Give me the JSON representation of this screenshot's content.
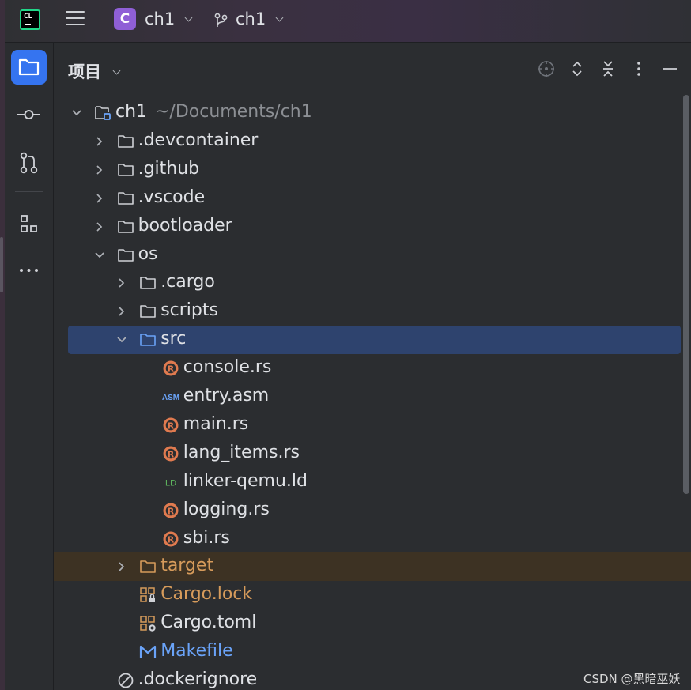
{
  "topbar": {
    "app_logo_text": "CL",
    "project_badge": "C",
    "project_name": "ch1",
    "branch_name": "ch1"
  },
  "sidebar": {
    "items": [
      {
        "name": "project",
        "icon": "folder-icon",
        "active": true
      },
      {
        "name": "commit",
        "icon": "commit-icon",
        "active": false
      },
      {
        "name": "pull-requests",
        "icon": "pull-request-icon",
        "active": false
      },
      {
        "name": "structure",
        "icon": "structure-icon",
        "active": false
      },
      {
        "name": "more",
        "icon": "more-icon",
        "active": false
      }
    ]
  },
  "panel": {
    "title": "项目",
    "actions": [
      "locate-icon",
      "expand-collapse-icon",
      "collapse-all-icon",
      "more-icon",
      "minimize-icon"
    ]
  },
  "tree": [
    {
      "label": "ch1",
      "path": "~/Documents/ch1",
      "icon": "module-folder-icon",
      "depth": 0,
      "expanded": true
    },
    {
      "label": ".devcontainer",
      "icon": "folder-icon",
      "depth": 1,
      "expanded": false
    },
    {
      "label": ".github",
      "icon": "folder-icon",
      "depth": 1,
      "expanded": false
    },
    {
      "label": ".vscode",
      "icon": "folder-icon",
      "depth": 1,
      "expanded": false
    },
    {
      "label": "bootloader",
      "icon": "folder-icon",
      "depth": 1,
      "expanded": false
    },
    {
      "label": "os",
      "icon": "folder-icon",
      "depth": 1,
      "expanded": true
    },
    {
      "label": ".cargo",
      "icon": "folder-icon",
      "depth": 2,
      "expanded": false
    },
    {
      "label": "scripts",
      "icon": "folder-icon",
      "depth": 2,
      "expanded": false
    },
    {
      "label": "src",
      "icon": "source-folder-icon",
      "depth": 2,
      "expanded": true,
      "selected": true
    },
    {
      "label": "console.rs",
      "icon": "rust-icon",
      "depth": 3
    },
    {
      "label": "entry.asm",
      "icon": "asm-icon",
      "depth": 3
    },
    {
      "label": "main.rs",
      "icon": "rust-icon",
      "depth": 3
    },
    {
      "label": "lang_items.rs",
      "icon": "rust-icon",
      "depth": 3
    },
    {
      "label": "linker-qemu.ld",
      "icon": "ld-icon",
      "depth": 3
    },
    {
      "label": "logging.rs",
      "icon": "rust-icon",
      "depth": 3
    },
    {
      "label": "sbi.rs",
      "icon": "rust-icon",
      "depth": 3
    },
    {
      "label": "target",
      "icon": "excluded-folder-icon",
      "depth": 2,
      "expanded": false,
      "excluded": true
    },
    {
      "label": "Cargo.lock",
      "icon": "cargo-lock-icon",
      "depth": 2,
      "color": "orange"
    },
    {
      "label": "Cargo.toml",
      "icon": "cargo-toml-icon",
      "depth": 2
    },
    {
      "label": "Makefile",
      "icon": "makefile-icon",
      "depth": 2,
      "color": "blue"
    },
    {
      "label": ".dockerignore",
      "icon": "ignore-icon",
      "depth": 1
    }
  ],
  "icon_text": {
    "asm": "ASM",
    "ld": "LD"
  },
  "watermark": "CSDN @黑暗巫妖",
  "colors": {
    "accent": "#3574f0",
    "selection": "#2e436e",
    "excluded_bg": "#3d3223",
    "excluded_text": "#d69b5b",
    "makefile_text": "#6aa3f8",
    "rust_icon": "#e07a4f"
  }
}
